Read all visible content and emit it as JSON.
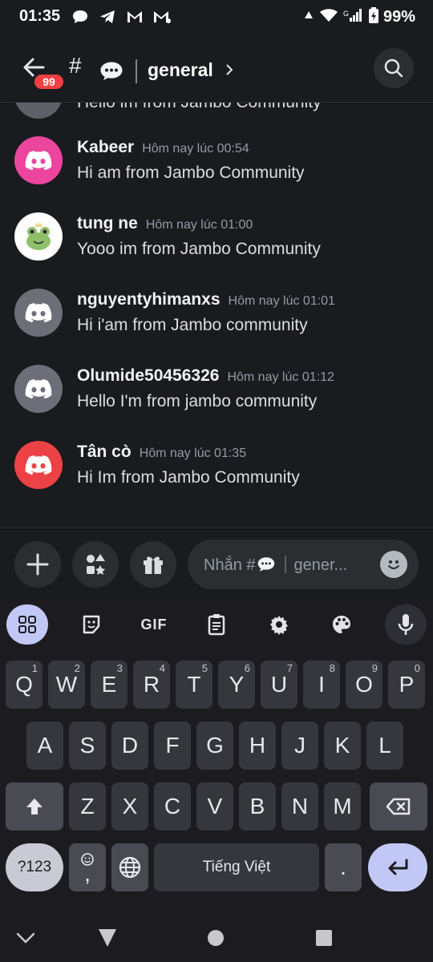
{
  "status_bar": {
    "time": "01:35",
    "battery": "99%",
    "notification_icons": [
      "chat-bubble-icon",
      "telegram-icon",
      "gmail-icon",
      "gmail-icon"
    ],
    "network_label": "G"
  },
  "header": {
    "back_badge": "99",
    "hash": "#",
    "channel_name": "general",
    "chevron": "›"
  },
  "messages": {
    "cut_text": "Hello im from Jambo Community",
    "items": [
      {
        "author": "Kabeer",
        "time": "Hôm nay lúc 00:54",
        "text": "Hi am from Jambo Community",
        "avatar_color": "#eb459e"
      },
      {
        "author": "tung ne",
        "time": "Hôm nay lúc 01:00",
        "text": "Yooo im from Jambo Community",
        "avatar_color": "#ffffff"
      },
      {
        "author": "nguyentyhimanxs",
        "time": "Hôm nay lúc 01:01",
        "text": "Hi i'am from Jambo community",
        "avatar_color": "#6d6f78"
      },
      {
        "author": "Olumide50456326",
        "time": "Hôm nay lúc 01:12",
        "text": "Hello I'm from jambo community",
        "avatar_color": "#6d6f78"
      },
      {
        "author": "Tân cò",
        "time": "Hôm nay lúc 01:35",
        "text": "Hi Im from Jambo Community",
        "avatar_color": "#ed4245"
      }
    ]
  },
  "composer": {
    "placeholder_prefix": "Nhắn #",
    "placeholder_suffix": "gener..."
  },
  "keyboard": {
    "gif_label": "GIF",
    "row1": [
      {
        "l": "Q",
        "n": "1"
      },
      {
        "l": "W",
        "n": "2"
      },
      {
        "l": "E",
        "n": "3"
      },
      {
        "l": "R",
        "n": "4"
      },
      {
        "l": "T",
        "n": "5"
      },
      {
        "l": "Y",
        "n": "6"
      },
      {
        "l": "U",
        "n": "7"
      },
      {
        "l": "I",
        "n": "8"
      },
      {
        "l": "O",
        "n": "9"
      },
      {
        "l": "P",
        "n": "0"
      }
    ],
    "row2": [
      "A",
      "S",
      "D",
      "F",
      "G",
      "H",
      "J",
      "K",
      "L"
    ],
    "row3": [
      "Z",
      "X",
      "C",
      "V",
      "B",
      "N",
      "M"
    ],
    "symbols_label": "?123",
    "emoji_comma_label": ",",
    "space_label": "Tiếng Việt",
    "period_label": "."
  },
  "colors": {
    "accent": "#c2c8f5",
    "badge": "#f23f42",
    "background": "#1a1b1f"
  }
}
